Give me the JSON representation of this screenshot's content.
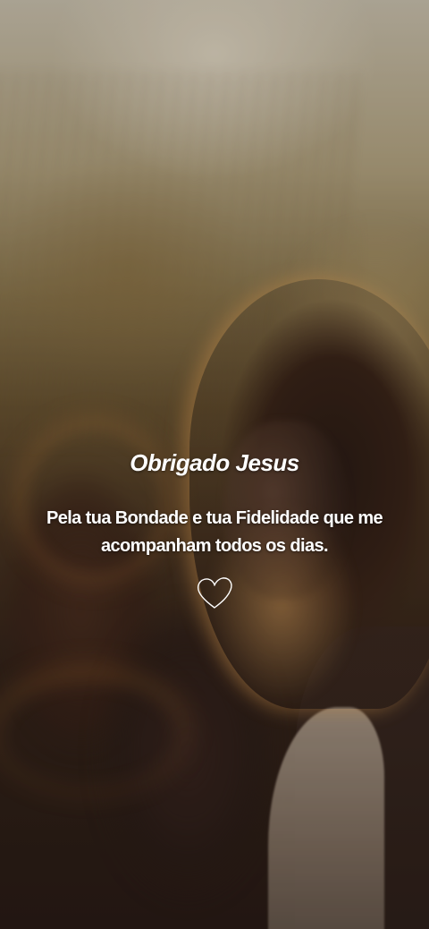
{
  "title": "Obrigado Jesus",
  "message": "Pela tua Bondade e tua Fidelidade que me acompanham todos os dias.",
  "icons": {
    "heart": "heart-outline-icon"
  },
  "colors": {
    "text": "#ffffff",
    "background_warm": "#8f7a50",
    "background_dark": "#2a1c16"
  }
}
